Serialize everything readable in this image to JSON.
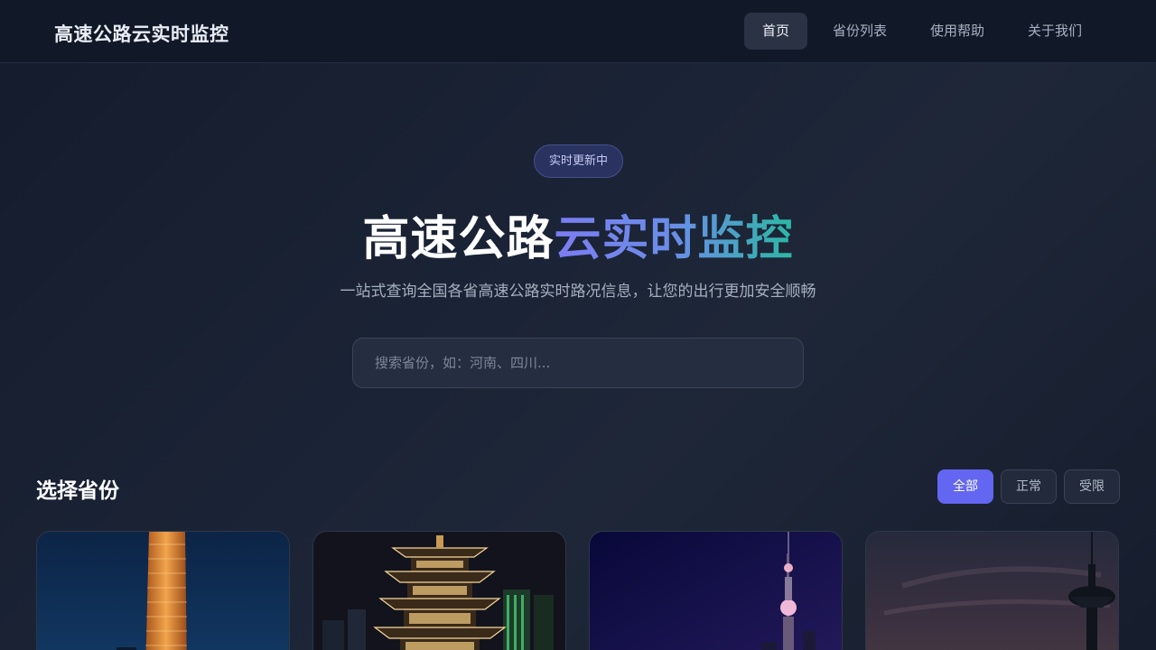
{
  "header": {
    "brand": "高速公路云实时监控",
    "nav": [
      {
        "label": "首页",
        "active": true
      },
      {
        "label": "省份列表",
        "active": false
      },
      {
        "label": "使用帮助",
        "active": false
      },
      {
        "label": "关于我们",
        "active": false
      }
    ]
  },
  "hero": {
    "badge": "实时更新中",
    "title_plain": "高速公路",
    "title_gradient": "云实时监控",
    "subtitle": "一站式查询全国各省高速公路实时路况信息，让您的出行更加安全顺畅",
    "search_placeholder": "搜索省份，如：河南、四川..."
  },
  "provinces": {
    "title": "选择省份",
    "filters": [
      {
        "label": "全部",
        "active": true
      },
      {
        "label": "正常",
        "active": false
      },
      {
        "label": "受限",
        "active": false
      }
    ],
    "cards": [
      {
        "image": "lit-skyscraper-night"
      },
      {
        "image": "illuminated-pagoda-night"
      },
      {
        "image": "tv-tower-skyline-night"
      },
      {
        "image": "tv-tower-dusk"
      }
    ]
  },
  "colors": {
    "accent": "#6366f1",
    "gradient_start": "#7c7cf2",
    "gradient_end": "#2bb8a3",
    "background": "#1b2436"
  }
}
